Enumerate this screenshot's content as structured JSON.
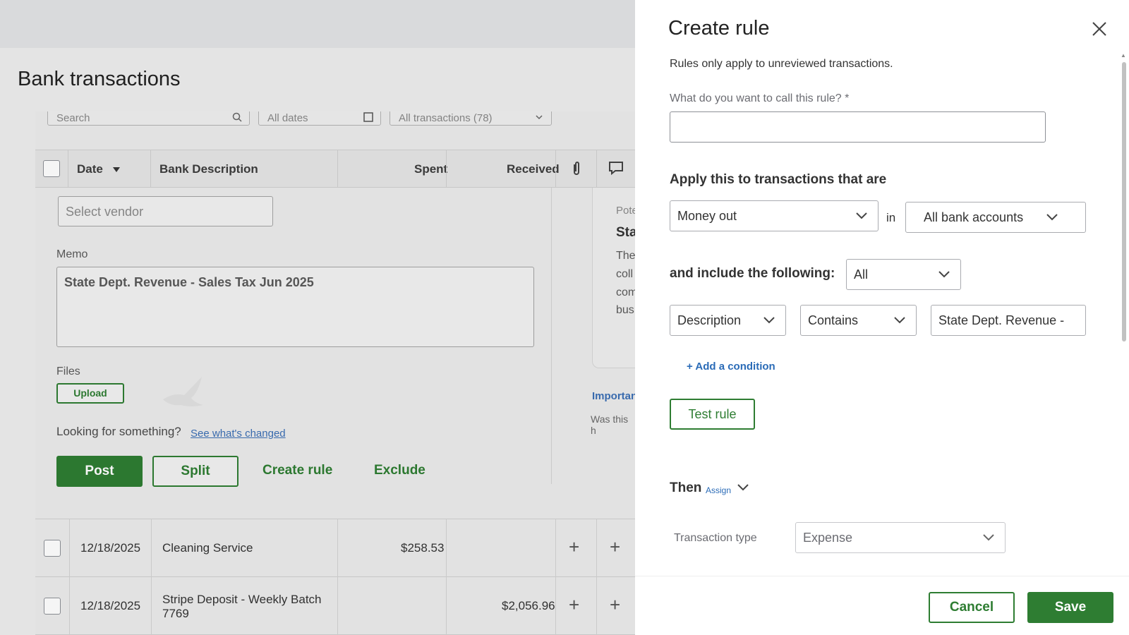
{
  "background": {
    "page_title": "Bank transactions",
    "filters": {
      "search_placeholder": "Search",
      "dates_label": "All dates",
      "transactions_label": "All transactions (78)"
    },
    "table": {
      "headers": {
        "date": "Date",
        "description": "Bank Description",
        "spent": "Spent",
        "received": "Received"
      },
      "expanded": {
        "vendor_placeholder": "Select vendor",
        "memo_label": "Memo",
        "memo_value": "State Dept. Revenue - Sales Tax Jun 2025",
        "files_label": "Files",
        "upload_label": "Upload",
        "looking_text": "Looking for something?",
        "see_changed_link": "See what's changed",
        "post_label": "Post",
        "split_label": "Split",
        "create_rule_label": "Create rule",
        "exclude_label": "Exclude",
        "tip": {
          "kicker": "Pote",
          "title": "Sta",
          "lines": [
            "The",
            "coll",
            "com",
            "bus"
          ]
        },
        "important_link": "Importan",
        "was_this": "Was this h"
      },
      "rows": [
        {
          "date": "12/18/2025",
          "description": "Cleaning Service",
          "spent": "$258.53",
          "received": "",
          "add1": "+",
          "add2": "+"
        },
        {
          "date": "12/18/2025",
          "description": "Stripe Deposit - Weekly Batch 7769",
          "spent": "",
          "received": "$2,056.96",
          "add1": "+",
          "add2": "+"
        }
      ]
    }
  },
  "drawer": {
    "title": "Create rule",
    "note": "Rules only apply to unreviewed transactions.",
    "name_label": "What do you want to call this rule? *",
    "name_value": "",
    "apply_heading": "Apply this to transactions that are",
    "direction_value": "Money out",
    "in_label": "in",
    "accounts_value": "All bank accounts",
    "include_heading": "and include the following:",
    "match_value": "All",
    "condition": {
      "field_value": "Description",
      "operator_value": "Contains",
      "text_value": "State Dept. Revenue -"
    },
    "add_condition": "+ Add a condition",
    "test_rule": "Test rule",
    "then_label": "Then",
    "assign_label": "Assign",
    "transaction_type_label": "Transaction type",
    "transaction_type_value": "Expense",
    "cancel_label": "Cancel",
    "save_label": "Save"
  },
  "colors": {
    "accent_green": "#2e7d32",
    "link_blue": "#2a6bb7"
  }
}
